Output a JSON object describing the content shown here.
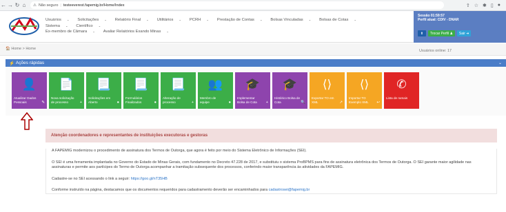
{
  "browser": {
    "warning": "Não seguro",
    "url": "testeeverest.fapemig.br/Home/Index"
  },
  "menu": {
    "row1": [
      "Usuários",
      "Solicitações",
      "Relatório Final",
      "Utilitários",
      "PCRH",
      "Prestação de Contas",
      "Bolsas Vinculadas",
      "Bolsas de Cotas"
    ],
    "row2": [
      "Sistema",
      "Científico"
    ],
    "row3": [
      "Ex-membro de Câmara",
      "Avaliar Relatórios Exando Minas"
    ]
  },
  "session": {
    "line1": "Sessão 01:59:57",
    "line2": "Perfil atual: CDIV - DNAR",
    "trocar": "Trocar Perfil",
    "sair": "Sair"
  },
  "breadcrumb": "Home > Home",
  "online": "Usuários online: 17",
  "panel_title": "Ações rápidas",
  "tiles": [
    {
      "label": "Atualizar Dados Pessoais",
      "color": "purple",
      "icon": "user-icon",
      "mini": "✎"
    },
    {
      "label": "Nova solicitação de processo",
      "color": "green",
      "icon": "document-icon",
      "mini": "+"
    },
    {
      "label": "Solicitações em Aberto",
      "color": "green",
      "icon": "document-list-icon",
      "mini": "●"
    },
    {
      "label": "Formulários Finalizados",
      "color": "green",
      "icon": "document-list-icon",
      "mini": "●"
    },
    {
      "label": "Alteração de processo",
      "color": "green",
      "icon": "document-list-icon",
      "mini": "+"
    },
    {
      "label": "Membro de equipe",
      "color": "green",
      "icon": "users-icon",
      "mini": "●"
    },
    {
      "label": "Implementar Bolsa de Cota",
      "color": "purple",
      "icon": "graduation-icon",
      "mini": "+"
    },
    {
      "label": "Histórico Bolsa de Cota",
      "color": "purple",
      "icon": "graduation-icon",
      "mini": "🔍"
    },
    {
      "label": "Exportar TO em XML",
      "color": "orange",
      "icon": "code-file-icon",
      "mini": "↗"
    },
    {
      "label": "Importar TO Exemplo XML",
      "color": "orange",
      "icon": "code-file-icon",
      "mini": "↩"
    },
    {
      "label": "Lista de ramais",
      "color": "red",
      "icon": "phone-icon",
      "mini": ""
    }
  ],
  "notice": {
    "title": "Atenção coordenadores e representantes de instituições executoras e gestoras",
    "p1": "A FAPEMIG modernizou o procedimento de assinatura dos Termos de Outorga, que agora é feito por meio do Sistema Eletrônico de Informações (SEI).",
    "p2": "O SEI é uma ferramenta implantada no Governo do Estado de Minas Gerais, com fundamento no Decreto 47.228 de 2017, e substituiu o sistema ProBPMS para fins de assinatura eletrônica dos Termos de Outorga. O SEI garante maior agilidade nas assinaturas e permite aos partícipes do Termo de Outorga acompanhar a tramitação subsequente dos processos, conferindo maior transparência às atividades da FAPEMIG.",
    "p3_text": "Cadastre-se no SEI acessando o link a seguir: ",
    "p3_link": "https://goo.gl/nT35HB",
    "p4_text": "Conforme instruído na página, destacamos que os documentos requeridos para cadastramento deverão ser encaminhados para ",
    "p4_link": "cadastrosei@fapemig.br"
  }
}
